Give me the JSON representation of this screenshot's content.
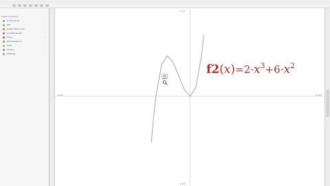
{
  "sidebar": {
    "header": "Graph Functions",
    "items": [
      {
        "label": "f1 Functions",
        "icon_color": "#6aa0d8"
      },
      {
        "label": "Plot",
        "icon_color": "#8bbf5e"
      },
      {
        "label": "Graph Entry Line",
        "icon_color": "#d88a4a"
      },
      {
        "label": "Analyze Graph",
        "icon_color": "#a678c9"
      },
      {
        "label": "Trace",
        "icon_color": "#d25b5b"
      },
      {
        "label": "Window/Zoom",
        "icon_color": "#5aa8a8"
      },
      {
        "label": "View",
        "icon_color": "#c9b44a"
      },
      {
        "label": "Actions",
        "icon_color": "#7a8fb0"
      },
      {
        "label": "Settings",
        "icon_color": "#9a9a9a"
      }
    ]
  },
  "graph": {
    "window": {
      "xmin": "-11.85",
      "xmax": "11.85",
      "ymin": "-17.81",
      "ymax": "17.41"
    },
    "formula": {
      "name": "f2",
      "var": "x",
      "coef1": "2",
      "exp1": "3",
      "coef2": "6",
      "exp2": "2"
    },
    "curve_color": "#9a9a9a",
    "formula_color": "#b52a2a"
  },
  "chart_data": {
    "type": "line",
    "function": "f2(x)=2·x^3+6·x^2",
    "series": [
      {
        "name": "f2",
        "x": [
          -3.4,
          -3.2,
          -3.0,
          -2.5,
          -2.0,
          -1.5,
          -1.0,
          -0.5,
          0.0,
          0.5,
          1.0,
          1.2
        ],
        "y": [
          -9.2,
          -4.1,
          0.0,
          6.25,
          8.0,
          6.75,
          4.0,
          1.25,
          0.0,
          1.75,
          8.0,
          12.1
        ]
      }
    ],
    "xlim": [
      -11.85,
      11.85
    ],
    "ylim": [
      -17.81,
      17.41
    ]
  }
}
